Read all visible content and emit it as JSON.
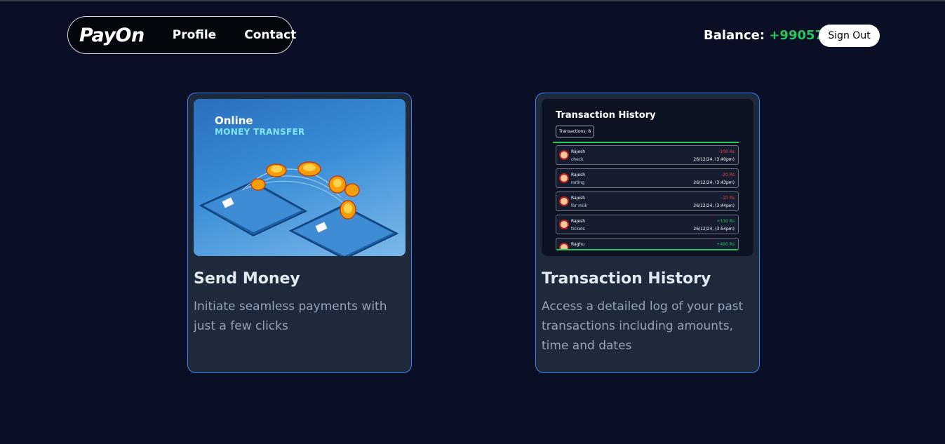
{
  "nav": {
    "logo": "PayOn",
    "profile": "Profile",
    "contact": "Contact"
  },
  "balance": {
    "label": "Balance: ",
    "value": "+99057"
  },
  "signout": "Sign Out",
  "cards": {
    "send": {
      "title": "Send Money",
      "desc": "Initiate seamless payments with just a few clicks",
      "image_text_1": "Online",
      "image_text_2": "MONEY TRANSFER"
    },
    "history": {
      "title": "Transaction History",
      "desc": "Access a detailed log of your past transactions including amounts, time and dates",
      "image_title": "Transaction History",
      "image_badge": "Transactions: 8",
      "rows": [
        {
          "name": "Rajesh",
          "note": "check",
          "amount": "-100 Rs",
          "date": "26/12/24, (3:40pm)",
          "sign": "neg"
        },
        {
          "name": "Rajesh",
          "note": "noting",
          "amount": "-20 Rs",
          "date": "26/12/24, (3:43pm)",
          "sign": "neg"
        },
        {
          "name": "Rajesh",
          "note": "for milk",
          "amount": "-10 Rs",
          "date": "26/12/24, (3:44pm)",
          "sign": "neg"
        },
        {
          "name": "Rajesh",
          "note": "tickets",
          "amount": "+130 Rs",
          "date": "26/12/24, (3:54pm)",
          "sign": "pos"
        },
        {
          "name": "Raghu",
          "note": "",
          "amount": "+400 Rs",
          "date": "",
          "sign": "pos"
        }
      ]
    }
  },
  "colors": {
    "background": "#0a0f25",
    "card": "#1e293b",
    "card_border": "#3b82f6",
    "balance_positive": "#22c55e"
  }
}
